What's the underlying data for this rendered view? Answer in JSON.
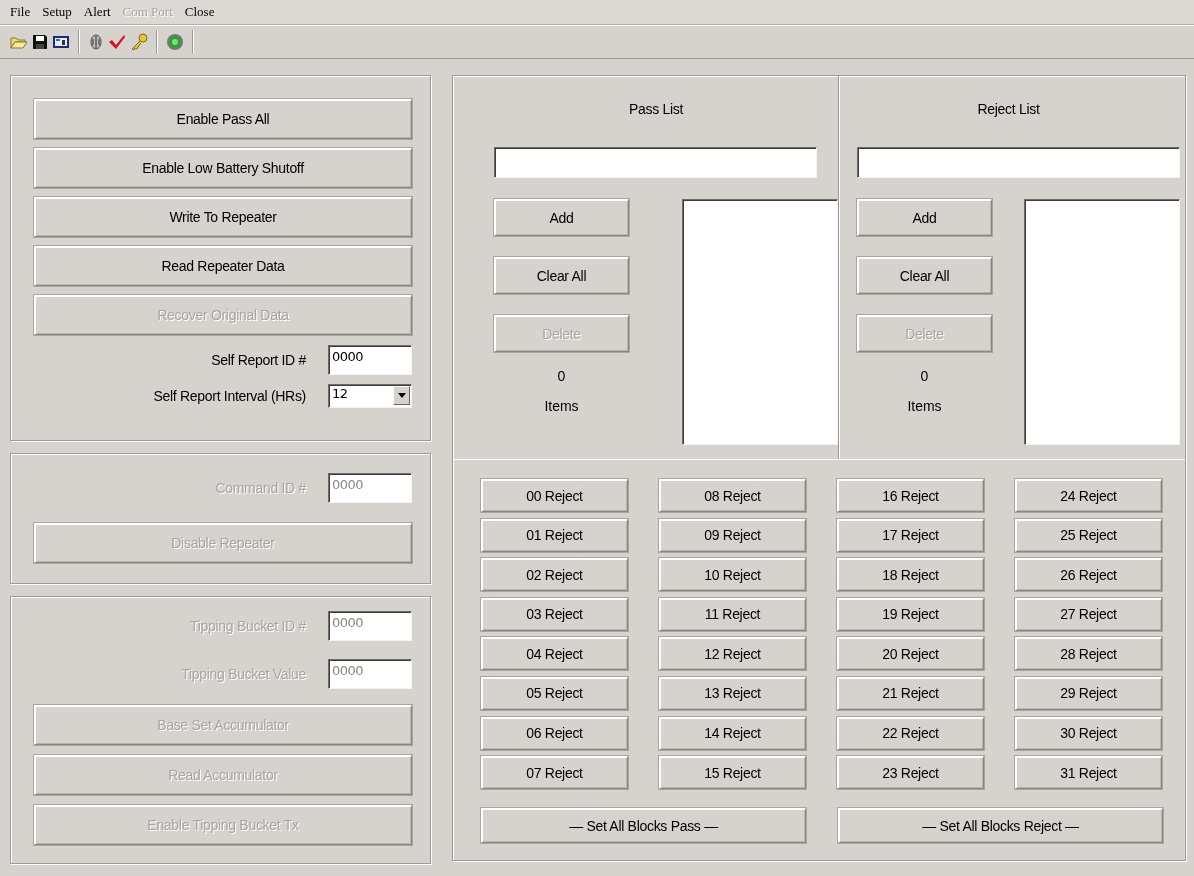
{
  "menu": [
    {
      "label": "File",
      "disabled": false
    },
    {
      "label": "Setup",
      "disabled": false
    },
    {
      "label": "Alert",
      "disabled": false
    },
    {
      "label": "Com Port",
      "disabled": true
    },
    {
      "label": "Close",
      "disabled": false
    }
  ],
  "settings": {
    "buttons": [
      {
        "label": "Enable Pass All",
        "disabled": false
      },
      {
        "label": "Enable Low Battery Shutoff",
        "disabled": false
      },
      {
        "label": "Write To Repeater",
        "disabled": false
      },
      {
        "label": "Read Repeater Data",
        "disabled": false
      },
      {
        "label": "Recover Original Data",
        "disabled": true
      }
    ],
    "fields": [
      {
        "kind": "text",
        "label": "Self Report ID #",
        "value": "0000",
        "disabled": false
      },
      {
        "kind": "dropdown",
        "label": "Self Report Interval (HRs)",
        "value": "12",
        "disabled": false
      }
    ]
  },
  "command": {
    "fields": [
      {
        "kind": "text",
        "label": "Command ID #",
        "value": "0000",
        "disabled": true
      }
    ],
    "buttons": [
      {
        "label": "Disable Repeater",
        "disabled": true
      }
    ]
  },
  "tipping_bucket": {
    "fields": [
      {
        "kind": "text",
        "label": "Tipping Bucket ID #",
        "value": "0000",
        "disabled": true
      },
      {
        "kind": "text",
        "label": "Tipping Bucket Value",
        "value": "0000",
        "disabled": true
      }
    ],
    "buttons": [
      {
        "label": "Base Set Accumulator",
        "disabled": true
      },
      {
        "label": "Read Accumulator",
        "disabled": true
      },
      {
        "label": "Enable Tipping Bucket Tx",
        "disabled": true
      }
    ]
  },
  "lists": [
    {
      "title": "Pass List",
      "buttons": [
        {
          "label": "Add",
          "disabled": false
        },
        {
          "label": "Clear All",
          "disabled": false
        },
        {
          "label": "Delete",
          "disabled": true
        }
      ],
      "count": "0",
      "count_label": "Items"
    },
    {
      "title": "Reject List",
      "buttons": [
        {
          "label": "Add",
          "disabled": false
        },
        {
          "label": "Clear All",
          "disabled": false
        },
        {
          "label": "Delete",
          "disabled": true
        }
      ],
      "count": "0",
      "count_label": "Items"
    }
  ],
  "blocks": [
    {
      "label": "00 Reject"
    },
    {
      "label": "01 Reject"
    },
    {
      "label": "02 Reject"
    },
    {
      "label": "03 Reject"
    },
    {
      "label": "04 Reject"
    },
    {
      "label": "05 Reject"
    },
    {
      "label": "06 Reject"
    },
    {
      "label": "07 Reject"
    },
    {
      "label": "08 Reject"
    },
    {
      "label": "09 Reject"
    },
    {
      "label": "10 Reject"
    },
    {
      "label": "11 Reject"
    },
    {
      "label": "12 Reject"
    },
    {
      "label": "13 Reject"
    },
    {
      "label": "14 Reject"
    },
    {
      "label": "15 Reject"
    },
    {
      "label": "16 Reject"
    },
    {
      "label": "17 Reject"
    },
    {
      "label": "18 Reject"
    },
    {
      "label": "19 Reject"
    },
    {
      "label": "20 Reject"
    },
    {
      "label": "21 Reject"
    },
    {
      "label": "22 Reject"
    },
    {
      "label": "23 Reject"
    },
    {
      "label": "24 Reject"
    },
    {
      "label": "25 Reject"
    },
    {
      "label": "26 Reject"
    },
    {
      "label": "27 Reject"
    },
    {
      "label": "28 Reject"
    },
    {
      "label": "29 Reject"
    },
    {
      "label": "30 Reject"
    },
    {
      "label": "31 Reject"
    }
  ],
  "set_all": [
    {
      "label": "— Set All Blocks Pass —"
    },
    {
      "label": "— Set All Blocks Reject —"
    }
  ]
}
